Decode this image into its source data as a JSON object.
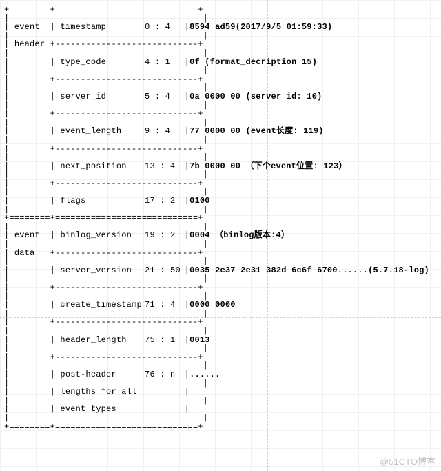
{
  "watermark": "@51CTO博客",
  "section_event_header": {
    "label": "event",
    "sublabel": "header"
  },
  "section_event_data": {
    "label": "event",
    "sublabel": "data"
  },
  "rows": [
    {
      "name": "timestamp",
      "offset": "0 : 4",
      "value": "8594 ad59(2017/9/5 01:59:33)"
    },
    {
      "name": "type_code",
      "offset": "4 : 1",
      "value": "0f (format_decription 15)"
    },
    {
      "name": "server_id",
      "offset": "5 : 4",
      "value": "0a 0000 00 (server id: 10)"
    },
    {
      "name": "event_length",
      "offset": "9 : 4",
      "value": "77 0000 00 (event长度: 119)"
    },
    {
      "name": "next_position",
      "offset": "13 : 4",
      "value": "7b 0000 00 （下个event位置: 123）"
    },
    {
      "name": "flags",
      "offset": "17 : 2",
      "value": "0100"
    },
    {
      "name": "binlog_version",
      "offset": "19 : 2",
      "value": "0004 （binlog版本:4）"
    },
    {
      "name": "server_version",
      "offset": "21 : 50",
      "value": "0035 2e37 2e31 382d 6c6f 6700......(5.7.18-log)"
    },
    {
      "name": "create_timestamp",
      "offset": "71 : 4",
      "value": "0000 0000"
    },
    {
      "name": "header_length",
      "offset": "75 : 1",
      "value": "0013"
    },
    {
      "name": "post-header",
      "offset": "76 : n",
      "value": "......"
    },
    {
      "name": "lengths for all",
      "offset": "",
      "value": ""
    },
    {
      "name": "event types",
      "offset": "",
      "value": ""
    }
  ]
}
